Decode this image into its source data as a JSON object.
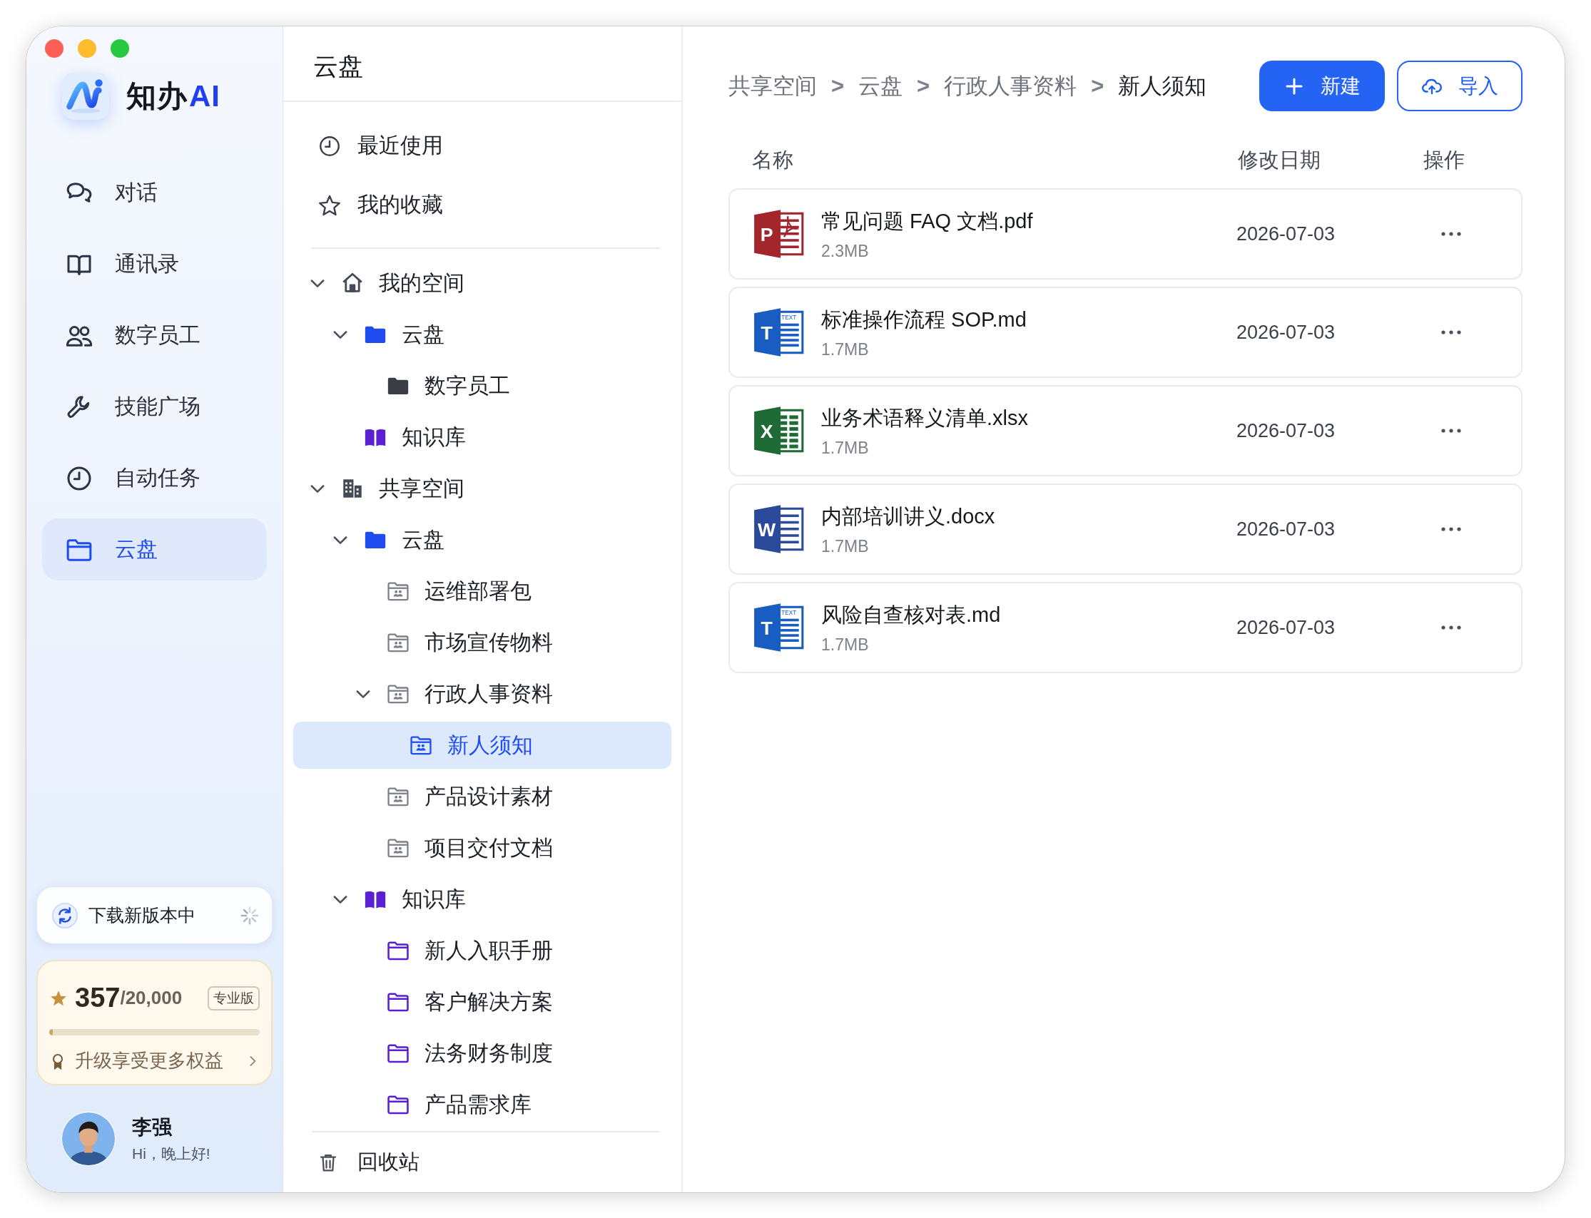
{
  "app": {
    "name": "知办",
    "name_accent": "AI"
  },
  "nav": [
    {
      "label": "对话",
      "selected": false
    },
    {
      "label": "通讯录",
      "selected": false
    },
    {
      "label": "数字员工",
      "selected": false
    },
    {
      "label": "技能广场",
      "selected": false
    },
    {
      "label": "自动任务",
      "selected": false
    },
    {
      "label": "云盘",
      "selected": true
    }
  ],
  "update": {
    "label": "下载新版本中"
  },
  "points": {
    "value": "357",
    "total": "/20,000",
    "plan": "专业版",
    "level": 0.018,
    "upgrade": "升级享受更多权益"
  },
  "user": {
    "name": "李强",
    "greeting": "Hi，晚上好!"
  },
  "drive": {
    "title": "云盘",
    "quick": [
      {
        "kind": "recent",
        "label": "最近使用"
      },
      {
        "kind": "favorite",
        "label": "我的收藏"
      }
    ],
    "tree": [
      {
        "kind": "home",
        "label": "我的空间",
        "expanded": true,
        "selected": false,
        "children": [
          {
            "kind": "drive",
            "label": "云盘",
            "expanded": true,
            "selected": false,
            "children": [
              {
                "kind": "folder",
                "label": "数字员工",
                "selected": false
              }
            ]
          },
          {
            "kind": "library",
            "label": "知识库",
            "selected": false
          }
        ]
      },
      {
        "kind": "building",
        "label": "共享空间",
        "expanded": true,
        "selected": false,
        "children": [
          {
            "kind": "drive",
            "label": "云盘",
            "expanded": true,
            "selected": false,
            "children": [
              {
                "kind": "shared-folder",
                "label": "运维部署包",
                "selected": false
              },
              {
                "kind": "shared-folder",
                "label": "市场宣传物料",
                "selected": false
              },
              {
                "kind": "shared-folder",
                "label": "行政人事资料",
                "expanded": true,
                "selected": false,
                "children": [
                  {
                    "kind": "shared-folder",
                    "label": "新人须知",
                    "selected": true
                  }
                ]
              },
              {
                "kind": "shared-folder",
                "label": "产品设计素材",
                "selected": false
              },
              {
                "kind": "shared-folder",
                "label": "项目交付文档",
                "selected": false
              }
            ]
          },
          {
            "kind": "library",
            "label": "知识库",
            "expanded": true,
            "selected": false,
            "children": [
              {
                "kind": "kb-folder",
                "label": "新人入职手册",
                "selected": false
              },
              {
                "kind": "kb-folder",
                "label": "客户解决方案",
                "selected": false
              },
              {
                "kind": "kb-folder",
                "label": "法务财务制度",
                "selected": false
              },
              {
                "kind": "kb-folder",
                "label": "产品需求库",
                "selected": false
              }
            ]
          }
        ]
      }
    ],
    "trash": "回收站"
  },
  "breadcrumb": [
    {
      "label": "共享空间",
      "separator": ">"
    },
    {
      "label": "云盘",
      "separator": ">"
    },
    {
      "label": "行政人事资料",
      "separator": ">"
    },
    {
      "label": "新人须知"
    }
  ],
  "actions": [
    {
      "kind": "primary",
      "label": "新建"
    },
    {
      "kind": "outline",
      "label": "导入"
    }
  ],
  "table": {
    "columns": [
      "名称",
      "修改日期",
      "操作"
    ],
    "rows": [
      {
        "kind": "pdf",
        "badge": "P",
        "name": "常见问题 FAQ 文档.pdf",
        "size": "2.3MB",
        "date": "2026-07-03"
      },
      {
        "kind": "text",
        "badge": "T",
        "tag": "TEXT",
        "name": "标准操作流程 SOP.md",
        "size": "1.7MB",
        "date": "2026-07-03"
      },
      {
        "kind": "excel",
        "badge": "X",
        "name": "业务术语释义清单.xlsx",
        "size": "1.7MB",
        "date": "2026-07-03"
      },
      {
        "kind": "word",
        "badge": "W",
        "name": "内部培训讲义.docx",
        "size": "1.7MB",
        "date": "2026-07-03"
      },
      {
        "kind": "text",
        "badge": "T",
        "tag": "TEXT",
        "name": "风险自查核对表.md",
        "size": "1.7MB",
        "date": "2026-07-03"
      }
    ]
  }
}
